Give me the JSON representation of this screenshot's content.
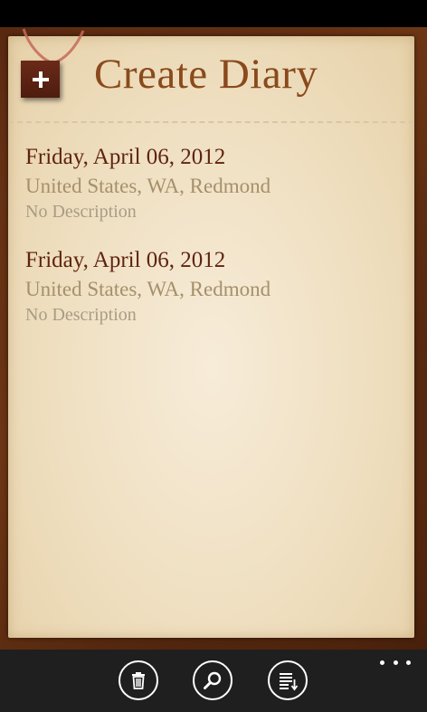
{
  "header": {
    "title": "Create Diary",
    "add_icon": "plus-icon"
  },
  "entries": [
    {
      "date": "Friday, April 06, 2012",
      "location": "United States, WA, Redmond",
      "description": "No Description"
    },
    {
      "date": "Friday, April 06, 2012",
      "location": "United States, WA, Redmond",
      "description": "No Description"
    }
  ],
  "app_bar": {
    "buttons": [
      {
        "icon": "trash-icon"
      },
      {
        "icon": "search-icon"
      },
      {
        "icon": "sort-list-icon"
      }
    ],
    "more_icon": "ellipsis-icon"
  },
  "colors": {
    "title": "#8a4a1c",
    "date": "#5e2410",
    "location": "#a5906a",
    "description": "#a89c86",
    "app_bar": "#1f1f1f"
  }
}
